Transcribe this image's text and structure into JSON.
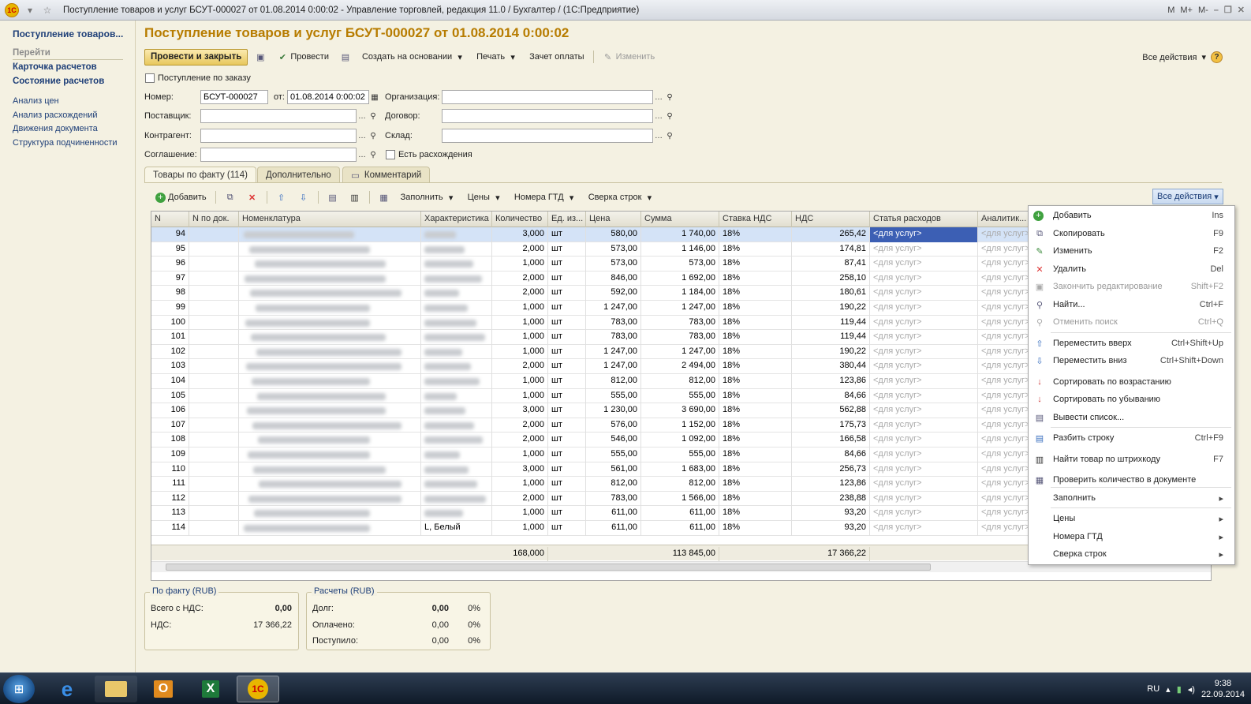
{
  "window": {
    "title": "Поступление товаров и услуг БСУТ-000027 от 01.08.2014 0:00:02 - Управление торговлей, редакция 11.0 / Бухгалтер /  (1С:Предприятие)",
    "logo": "1С",
    "right_icons": [
      "M",
      "M+",
      "M-"
    ]
  },
  "sidebar": {
    "title": "Поступление товаров...",
    "goto_label": "Перейти",
    "bold_links": [
      "Карточка расчетов",
      "Состояние расчетов"
    ],
    "links": [
      "Анализ цен",
      "Анализ расхождений",
      "Движения документа",
      "Структура подчиненности"
    ]
  },
  "doc": {
    "title": "Поступление товаров и услуг БСУТ-000027 от 01.08.2014 0:00:02",
    "toolbar": {
      "post_close": "Провести и закрыть",
      "post": "Провести",
      "create_base": "Создать на основании",
      "print": "Печать",
      "offset": "Зачет оплаты",
      "edit": "Изменить",
      "all_actions": "Все действия",
      "help": "?"
    },
    "by_order_label": "Поступление по заказу",
    "number_label": "Номер:",
    "number_value": "БСУТ-000027",
    "from_label": "от:",
    "date_value": "01.08.2014  0:00:02",
    "org_label": "Организация:",
    "supplier_label": "Поставщик:",
    "contract_label": "Договор:",
    "counterparty_label": "Контрагент:",
    "warehouse_label": "Склад:",
    "agreement_label": "Соглашение:",
    "discrepancy_label": "Есть расхождения",
    "tabs": [
      "Товары по факту (114)",
      "Дополнительно",
      "Комментарий"
    ]
  },
  "grid_toolbar": {
    "add": "Добавить",
    "fill": "Заполнить",
    "prices": "Цены",
    "gtd": "Номера ГТД",
    "reconcile": "Сверка строк",
    "all_actions": "Все действия"
  },
  "columns": [
    "N",
    "N по док.",
    "Номенклатура",
    "Характеристика",
    "Количество",
    "Ед. из...",
    "Цена",
    "Сумма",
    "Ставка НДС",
    "НДС",
    "Статья расходов",
    "Аналитик..."
  ],
  "rows": [
    {
      "n": "94",
      "qty": "3,000",
      "unit": "шт",
      "price": "580,00",
      "sum": "1 740,00",
      "rate": "18%",
      "vat": "265,42",
      "expense": "<для услуг>",
      "char": ""
    },
    {
      "n": "95",
      "qty": "2,000",
      "unit": "шт",
      "price": "573,00",
      "sum": "1 146,00",
      "rate": "18%",
      "vat": "174,81",
      "expense": "<для услуг>",
      "char": ""
    },
    {
      "n": "96",
      "qty": "1,000",
      "unit": "шт",
      "price": "573,00",
      "sum": "573,00",
      "rate": "18%",
      "vat": "87,41",
      "expense": "<для услуг>",
      "char": ""
    },
    {
      "n": "97",
      "qty": "2,000",
      "unit": "шт",
      "price": "846,00",
      "sum": "1 692,00",
      "rate": "18%",
      "vat": "258,10",
      "expense": "<для услуг>",
      "char": ""
    },
    {
      "n": "98",
      "qty": "2,000",
      "unit": "шт",
      "price": "592,00",
      "sum": "1 184,00",
      "rate": "18%",
      "vat": "180,61",
      "expense": "<для услуг>",
      "char": ""
    },
    {
      "n": "99",
      "qty": "1,000",
      "unit": "шт",
      "price": "1 247,00",
      "sum": "1 247,00",
      "rate": "18%",
      "vat": "190,22",
      "expense": "<для услуг>",
      "char": ""
    },
    {
      "n": "100",
      "qty": "1,000",
      "unit": "шт",
      "price": "783,00",
      "sum": "783,00",
      "rate": "18%",
      "vat": "119,44",
      "expense": "<для услуг>",
      "char": ""
    },
    {
      "n": "101",
      "qty": "1,000",
      "unit": "шт",
      "price": "783,00",
      "sum": "783,00",
      "rate": "18%",
      "vat": "119,44",
      "expense": "<для услуг>",
      "char": ""
    },
    {
      "n": "102",
      "qty": "1,000",
      "unit": "шт",
      "price": "1 247,00",
      "sum": "1 247,00",
      "rate": "18%",
      "vat": "190,22",
      "expense": "<для услуг>",
      "char": ""
    },
    {
      "n": "103",
      "qty": "2,000",
      "unit": "шт",
      "price": "1 247,00",
      "sum": "2 494,00",
      "rate": "18%",
      "vat": "380,44",
      "expense": "<для услуг>",
      "char": ""
    },
    {
      "n": "104",
      "qty": "1,000",
      "unit": "шт",
      "price": "812,00",
      "sum": "812,00",
      "rate": "18%",
      "vat": "123,86",
      "expense": "<для услуг>",
      "char": ""
    },
    {
      "n": "105",
      "qty": "1,000",
      "unit": "шт",
      "price": "555,00",
      "sum": "555,00",
      "rate": "18%",
      "vat": "84,66",
      "expense": "<для услуг>",
      "char": ""
    },
    {
      "n": "106",
      "qty": "3,000",
      "unit": "шт",
      "price": "1 230,00",
      "sum": "3 690,00",
      "rate": "18%",
      "vat": "562,88",
      "expense": "<для услуг>",
      "char": ""
    },
    {
      "n": "107",
      "qty": "2,000",
      "unit": "шт",
      "price": "576,00",
      "sum": "1 152,00",
      "rate": "18%",
      "vat": "175,73",
      "expense": "<для услуг>",
      "char": ""
    },
    {
      "n": "108",
      "qty": "2,000",
      "unit": "шт",
      "price": "546,00",
      "sum": "1 092,00",
      "rate": "18%",
      "vat": "166,58",
      "expense": "<для услуг>",
      "char": ""
    },
    {
      "n": "109",
      "qty": "1,000",
      "unit": "шт",
      "price": "555,00",
      "sum": "555,00",
      "rate": "18%",
      "vat": "84,66",
      "expense": "<для услуг>",
      "char": ""
    },
    {
      "n": "110",
      "qty": "3,000",
      "unit": "шт",
      "price": "561,00",
      "sum": "1 683,00",
      "rate": "18%",
      "vat": "256,73",
      "expense": "<для услуг>",
      "char": ""
    },
    {
      "n": "111",
      "qty": "1,000",
      "unit": "шт",
      "price": "812,00",
      "sum": "812,00",
      "rate": "18%",
      "vat": "123,86",
      "expense": "<для услуг>",
      "char": ""
    },
    {
      "n": "112",
      "qty": "2,000",
      "unit": "шт",
      "price": "783,00",
      "sum": "1 566,00",
      "rate": "18%",
      "vat": "238,88",
      "expense": "<для услуг>",
      "char": ""
    },
    {
      "n": "113",
      "qty": "1,000",
      "unit": "шт",
      "price": "611,00",
      "sum": "611,00",
      "rate": "18%",
      "vat": "93,20",
      "expense": "<для услуг>",
      "char": ""
    },
    {
      "n": "114",
      "qty": "1,000",
      "unit": "шт",
      "price": "611,00",
      "sum": "611,00",
      "rate": "18%",
      "vat": "93,20",
      "expense": "<для услуг>",
      "char": "L, Белый"
    }
  ],
  "totals": {
    "qty": "168,000",
    "sum": "113 845,00",
    "vat": "17 366,22"
  },
  "fact_group": {
    "title": "По факту (RUB)",
    "total_label": "Всего с НДС:",
    "total_value": "0,00",
    "vat_label": "НДС:",
    "vat_value": "17 366,22"
  },
  "calc_group": {
    "title": "Расчеты (RUB)",
    "debt_label": "Долг:",
    "debt_value": "0,00",
    "debt_pct": "0%",
    "paid_label": "Оплачено:",
    "paid_value": "0,00",
    "paid_pct": "0%",
    "received_label": "Поступило:",
    "received_value": "0,00",
    "received_pct": "0%"
  },
  "context_menu": [
    {
      "label": "Добавить",
      "shortcut": "Ins",
      "icon": "add-icon",
      "disabled": false
    },
    {
      "label": "Скопировать",
      "shortcut": "F9",
      "icon": "copy-icon",
      "disabled": false
    },
    {
      "label": "Изменить",
      "shortcut": "F2",
      "icon": "pencil-icon",
      "disabled": false
    },
    {
      "label": "Удалить",
      "shortcut": "Del",
      "icon": "delete-icon",
      "disabled": false
    },
    {
      "label": "Закончить редактирование",
      "shortcut": "Shift+F2",
      "icon": "end-edit-icon",
      "disabled": true
    },
    {
      "label": "Найти...",
      "shortcut": "Ctrl+F",
      "icon": "search-icon",
      "disabled": false
    },
    {
      "label": "Отменить поиск",
      "shortcut": "Ctrl+Q",
      "icon": "cancel-search-icon",
      "disabled": true
    },
    {
      "label": "Переместить вверх",
      "shortcut": "Ctrl+Shift+Up",
      "icon": "arrow-up-icon",
      "disabled": false
    },
    {
      "label": "Переместить вниз",
      "shortcut": "Ctrl+Shift+Down",
      "icon": "arrow-down-icon",
      "disabled": false
    },
    {
      "label": "Сортировать по возрастанию",
      "shortcut": "",
      "icon": "sort-asc-icon",
      "disabled": false
    },
    {
      "label": "Сортировать по убыванию",
      "shortcut": "",
      "icon": "sort-desc-icon",
      "disabled": false
    },
    {
      "label": "Вывести список...",
      "shortcut": "",
      "icon": "list-icon",
      "disabled": false
    },
    {
      "label": "Разбить строку",
      "shortcut": "Ctrl+F9",
      "icon": "split-icon",
      "disabled": false
    },
    {
      "label": "Найти товар по штрихкоду",
      "shortcut": "F7",
      "icon": "barcode-icon",
      "disabled": false
    },
    {
      "label": "Проверить количество в документе",
      "shortcut": "",
      "icon": "check-qty-icon",
      "disabled": false
    },
    {
      "label": "Заполнить",
      "shortcut": "▸",
      "icon": "",
      "disabled": false
    },
    {
      "label": "Цены",
      "shortcut": "▸",
      "icon": "",
      "disabled": false
    },
    {
      "label": "Номера ГТД",
      "shortcut": "▸",
      "icon": "",
      "disabled": false
    },
    {
      "label": "Сверка строк",
      "shortcut": "▸",
      "icon": "",
      "disabled": false
    }
  ],
  "taskbar": {
    "lang": "RU",
    "time": "9:38",
    "date": "22.09.2014"
  },
  "colors": {
    "accent": "#b77c00",
    "link": "#1e3f78",
    "selected": "#3c5fb4"
  }
}
